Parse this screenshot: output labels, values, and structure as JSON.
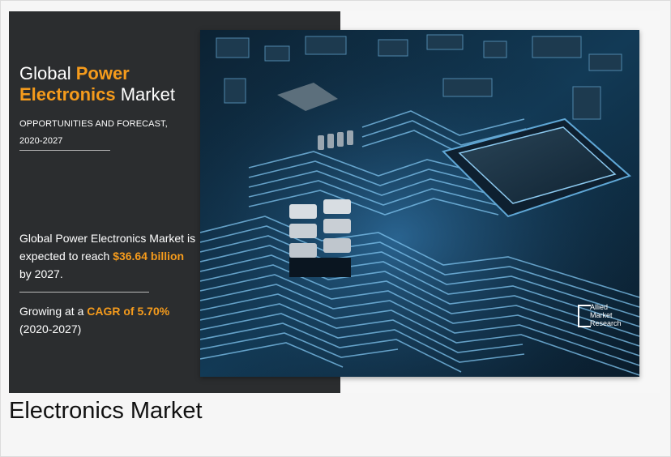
{
  "infographic": {
    "title_part1": "Global ",
    "title_accent1": "Power",
    "title_accent2": "Electronics",
    "title_part2": " Market",
    "subtitle_line1": "OPPORTUNITIES AND FORECAST,",
    "subtitle_line2": "2020-2027",
    "stat1_text": "Global Power Electronics Market is expected to reach",
    "stat1_value": "$36.64 billion",
    "stat1_suffix": " by 2027.",
    "stat2_prefix": "Growing at a ",
    "stat2_value": "CAGR of 5.70%",
    "stat2_suffix": "(2020-2027)",
    "logo_line1": "Allied",
    "logo_line2": "Market",
    "logo_line3": "Research",
    "accent_color": "#f59b1c",
    "background_color": "#2b2d2f"
  },
  "caption": "Electronics Market"
}
